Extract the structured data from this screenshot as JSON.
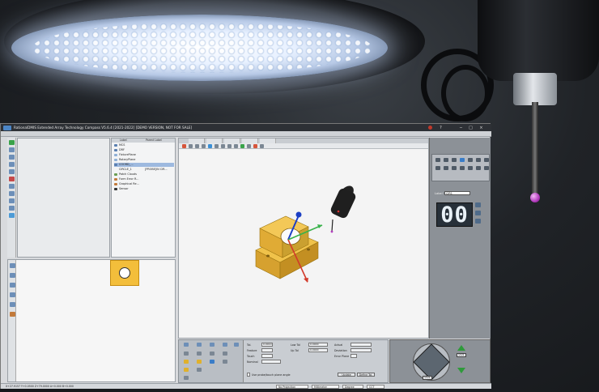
{
  "window": {
    "title": "RationalDMIS Extended Array Technology Compass V5.6.4   [2021-2022] [DEMO VERSION, NOT FOR SALE]",
    "minimize": "−",
    "maximize": "□",
    "close": "×"
  },
  "tree": {
    "col_label": "Label",
    "col_parent": "Parent Label",
    "items": [
      {
        "label": "MCS",
        "parent": ""
      },
      {
        "label": "DRF",
        "parent": ""
      },
      {
        "label": "FixturePlane",
        "parent": ""
      },
      {
        "label": "RotaryPlane",
        "parent": ""
      },
      {
        "label": "COORD_...",
        "parent": ""
      },
      {
        "label": "CIRCLE_1",
        "parent": "[PROBE]IN CIR..."
      },
      {
        "label": "Patch Clouds",
        "parent": ""
      },
      {
        "label": "Form Error R...",
        "parent": ""
      },
      {
        "label": "Graphical Re...",
        "parent": ""
      },
      {
        "label": "Sensor",
        "parent": ""
      }
    ],
    "selected_index": 4
  },
  "right_panel": {
    "label_caption": "Label",
    "label_value": "CIR1",
    "counter": "00"
  },
  "bottom_panel": {
    "fields": [
      {
        "caption": "Tol.",
        "value": "0.0010"
      },
      {
        "caption": "Feature",
        "value": ""
      },
      {
        "caption": "Touch",
        "value": ""
      },
      {
        "caption": "Nominal",
        "value": ""
      }
    ],
    "low_tol_caption": "Low Tol",
    "up_tol_caption": "Up Tol",
    "low_tol_value": "0.0000",
    "up_tol_value": "0.0000",
    "actual_caption": "Actual",
    "deviation_caption": "Deviation",
    "errorplane_caption": "Error Plane",
    "checkbox_label": "Use probe/touch plane angle",
    "button_update": "Update",
    "button_define": "Define Tol."
  },
  "jog": {
    "top_value": "0.01",
    "bottom_value": "0.01"
  },
  "statusbar": {
    "coords": "X+27.9157  Y+0.0500  Z+79.0000  A+0.000  B+0.000",
    "projection": "No Projection",
    "units": "Millimeter",
    "angle": "Degree",
    "mode": "CCT"
  },
  "colors": {
    "accent": "#4c86c6",
    "part": "#f3be3b",
    "axis_x": "#d23a2a",
    "axis_y": "#38b24a",
    "axis_z": "#1c3fc4",
    "ruby": "#b23bbd"
  }
}
